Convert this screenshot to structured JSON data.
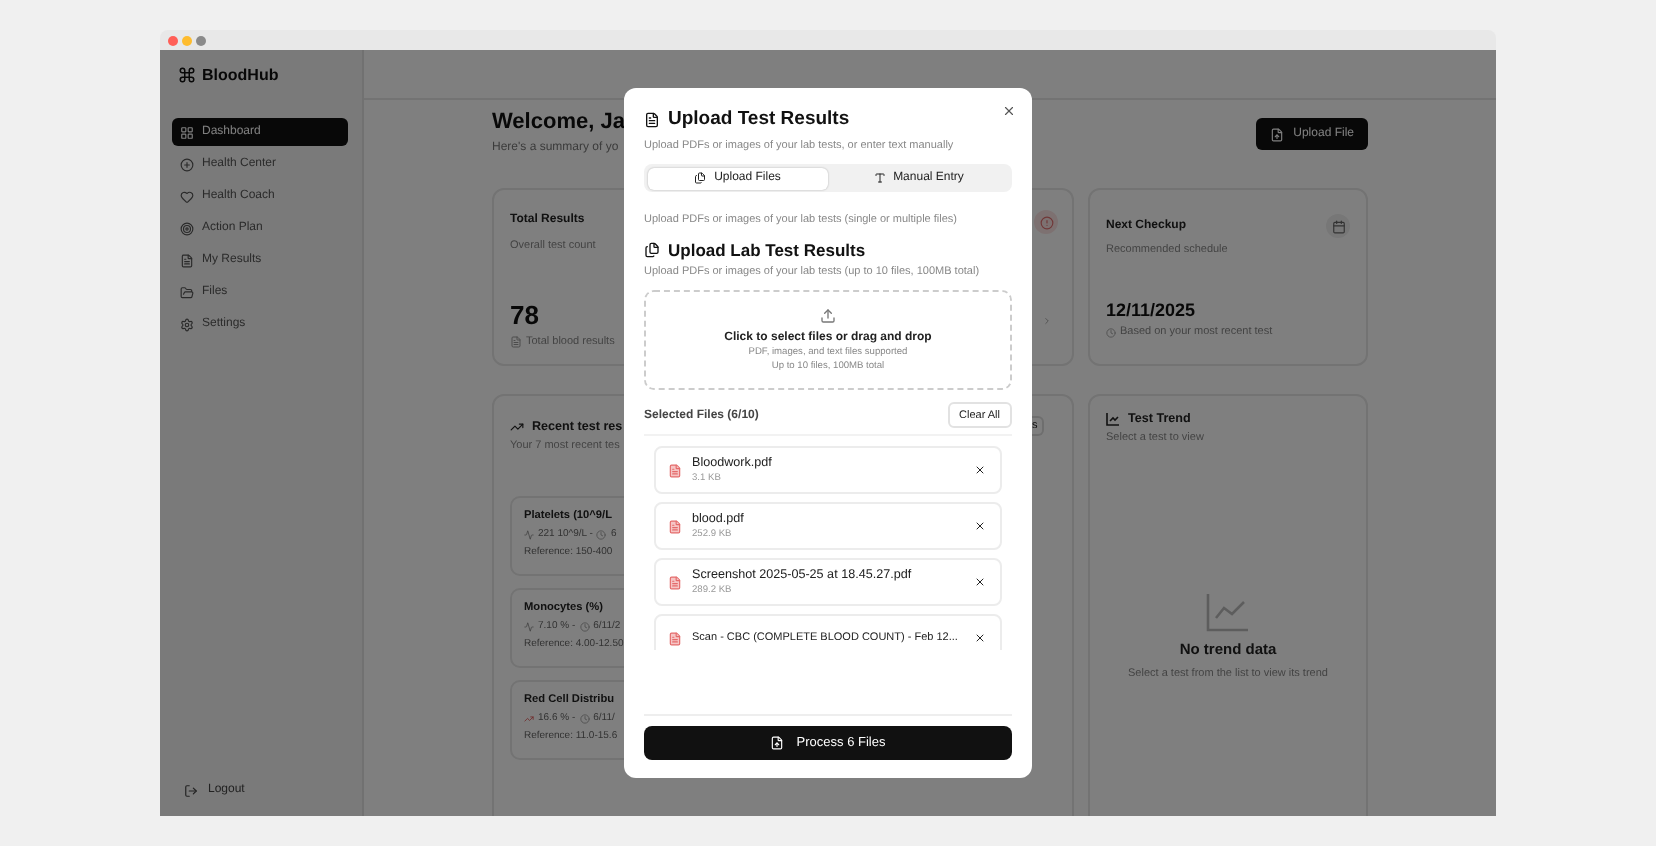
{
  "sidebar": {
    "brand": "BloodHub",
    "items": [
      {
        "label": "Dashboard",
        "selected": true
      },
      {
        "label": "Health Center",
        "selected": false
      },
      {
        "label": "Health Coach",
        "selected": false
      },
      {
        "label": "Action Plan",
        "selected": false
      },
      {
        "label": "My Results",
        "selected": false
      },
      {
        "label": "Files",
        "selected": false
      },
      {
        "label": "Settings",
        "selected": false
      }
    ],
    "logout": "Logout"
  },
  "header": {
    "title": "Welcome, Ja",
    "subtitle": "Here's a summary of yo",
    "upload_button": "Upload File"
  },
  "total_card": {
    "title": "Total Results",
    "subtitle": "Overall test count",
    "value": "78",
    "note": "Total blood results"
  },
  "recent_card": {
    "title": "Recent test res",
    "subtitle": "Your 7 most recent tes",
    "button": "s",
    "items": [
      {
        "name": "Platelets (10^9/L",
        "reading": "221 10^9/L -",
        "date": "6",
        "reference": "Reference: 150-400",
        "kind": "steady"
      },
      {
        "name": "Monocytes (%)",
        "reading": "7.10 % -",
        "date": "6/11/2",
        "reference": "Reference: 4.00-12.50",
        "kind": "steady"
      },
      {
        "name": "Red Cell Distribu",
        "reading": "16.6 % -",
        "date": "6/11/",
        "reference": "Reference: 11.0-15.6",
        "kind": "up"
      }
    ]
  },
  "next_checkup": {
    "title": "Next Checkup",
    "subtitle": "Recommended schedule",
    "date": "12/11/2025",
    "note": "Based on your most recent test"
  },
  "trend_card": {
    "title": "Test Trend",
    "subtitle": "Select a test to view",
    "empty_title": "No trend data",
    "empty_text": "Select a test from the list to view its trend"
  },
  "dialog": {
    "title": "Upload Test Results",
    "subtitle": "Upload PDFs or images of your lab tests, or enter text manually",
    "tabs": [
      {
        "label": "Upload Files",
        "selected": true
      },
      {
        "label": "Manual Entry",
        "selected": false
      }
    ],
    "tab_hint": "Upload PDFs or images of your lab tests (single or multiple files)",
    "section_title": "Upload Lab Test Results",
    "section_subtitle": "Upload PDFs or images of your lab tests (up to 10 files, 100MB total)",
    "dropzone": {
      "title": "Click to select files or drag and drop",
      "formats": "PDF, images, and text files supported",
      "limit": "Up to 10 files, 100MB total"
    },
    "selected_label": "Selected Files (6/10)",
    "clear_button": "Clear All",
    "files": [
      {
        "name": "Bloodwork.pdf",
        "size": "3.1 KB"
      },
      {
        "name": "blood.pdf",
        "size": "252.9 KB"
      },
      {
        "name": "Screenshot 2025-05-25 at 18.45.27.pdf",
        "size": "289.2 KB"
      },
      {
        "name": "Scan - CBC (COMPLETE BLOOD COUNT) - Feb 12..."
      }
    ],
    "process_button": "Process 6 Files"
  }
}
